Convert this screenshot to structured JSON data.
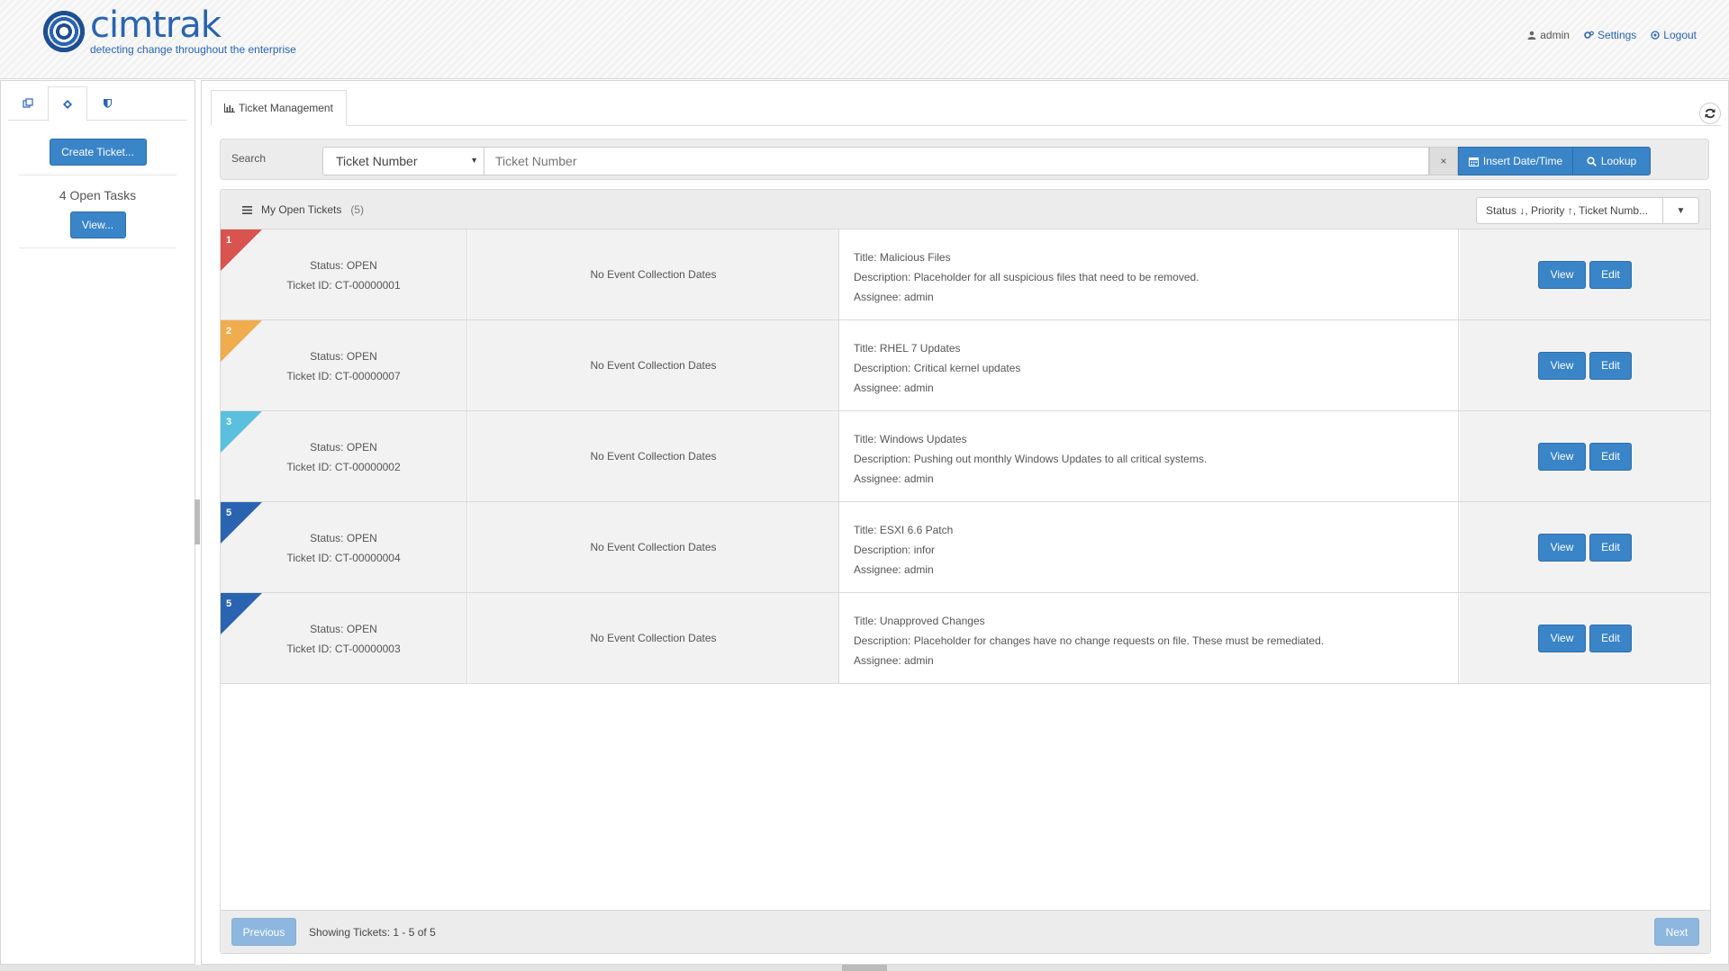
{
  "brand": {
    "name": "cimtrak",
    "tagline": "detecting change throughout the enterprise"
  },
  "topnav": {
    "user": "admin",
    "settings": "Settings",
    "logout": "Logout"
  },
  "sidebar": {
    "tabs": [
      {
        "icon": "copy-icon"
      },
      {
        "icon": "ticket-icon",
        "active": true
      },
      {
        "icon": "shield-icon"
      }
    ],
    "create_button": "Create Ticket...",
    "open_tasks": "4 Open Tasks",
    "view_button": "View..."
  },
  "main": {
    "tab_label": "Ticket Management",
    "search": {
      "label": "Search",
      "field": "Ticket Number",
      "placeholder": "Ticket Number",
      "clear": "×",
      "insert_button": "Insert Date/Time",
      "lookup_button": "Lookup"
    },
    "panel": {
      "title": "My Open Tickets",
      "count": "(5)",
      "sort": "Status ↓, Priority ↑, Ticket Numb..."
    },
    "tickets": [
      {
        "priority": "1",
        "color": "#d9534f",
        "status": "Status: OPEN",
        "id": "Ticket ID: CT-00000001",
        "dates": "No Event Collection Dates",
        "title": "Title: Malicious Files",
        "description": "Description: Placeholder for all suspicious files that need to be removed.",
        "assignee": "Assignee: admin",
        "view": "View",
        "edit": "Edit"
      },
      {
        "priority": "2",
        "color": "#f0ad4e",
        "status": "Status: OPEN",
        "id": "Ticket ID: CT-00000007",
        "dates": "No Event Collection Dates",
        "title": "Title: RHEL 7 Updates",
        "description": "Description: Critical kernel updates",
        "assignee": "Assignee: admin",
        "view": "View",
        "edit": "Edit"
      },
      {
        "priority": "3",
        "color": "#5bc0de",
        "status": "Status: OPEN",
        "id": "Ticket ID: CT-00000002",
        "dates": "No Event Collection Dates",
        "title": "Title: Windows Updates",
        "description": "Description: Pushing out monthly Windows Updates to all critical systems.",
        "assignee": "Assignee: admin",
        "view": "View",
        "edit": "Edit"
      },
      {
        "priority": "5",
        "color": "#2a64b0",
        "status": "Status: OPEN",
        "id": "Ticket ID: CT-00000004",
        "dates": "No Event Collection Dates",
        "title": "Title: ESXI 6.6 Patch",
        "description": "Description: infor",
        "assignee": "Assignee: admin",
        "view": "View",
        "edit": "Edit"
      },
      {
        "priority": "5",
        "color": "#2a64b0",
        "status": "Status: OPEN",
        "id": "Ticket ID: CT-00000003",
        "dates": "No Event Collection Dates",
        "title": "Title: Unapproved Changes",
        "description": "Description: Placeholder for changes have no change requests on file. These must be remediated.",
        "assignee": "Assignee: admin",
        "view": "View",
        "edit": "Edit"
      }
    ],
    "footer": {
      "previous": "Previous",
      "showing": "Showing Tickets: 1 - 5 of 5",
      "next": "Next"
    }
  }
}
